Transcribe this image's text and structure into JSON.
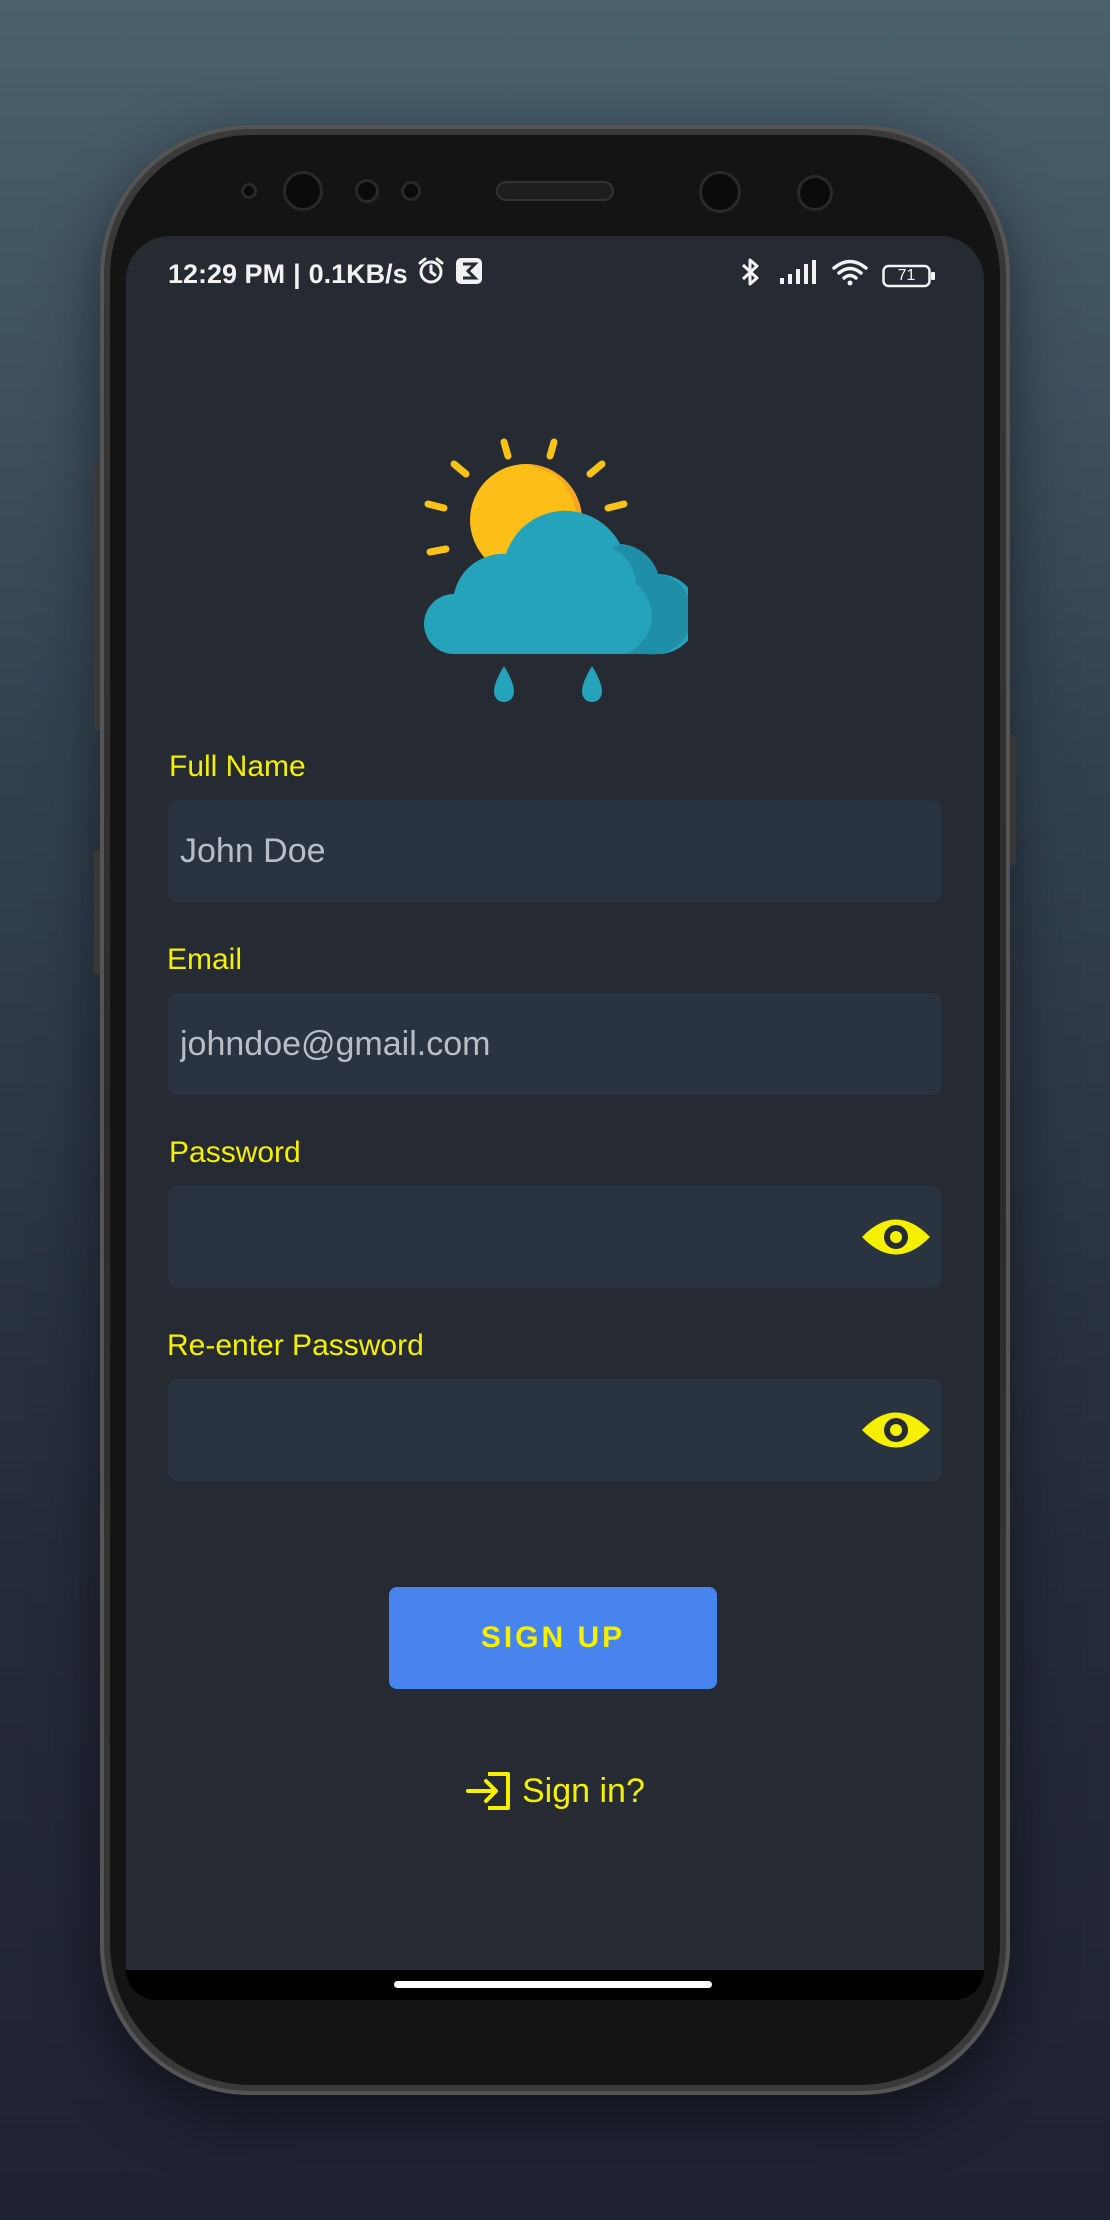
{
  "status_bar": {
    "time": "12:29 PM",
    "separator": "|",
    "network_speed": "0.1KB/s",
    "battery_level": "71",
    "icons": [
      "alarm-icon",
      "notification-app-icon",
      "bluetooth-icon",
      "signal-icon",
      "wifi-icon",
      "battery-icon"
    ]
  },
  "logo": {
    "icon": "weather-sun-cloud-rain-icon"
  },
  "form": {
    "full_name": {
      "label": "Full Name",
      "value": "",
      "placeholder": "John Doe"
    },
    "email": {
      "label": "Email",
      "value": "",
      "placeholder": "johndoe@gmail.com"
    },
    "password": {
      "label": "Password",
      "value": "",
      "placeholder": "",
      "toggle_icon": "eye-icon"
    },
    "confirm_password": {
      "label": "Re-enter Password",
      "value": "",
      "placeholder": "",
      "toggle_icon": "eye-icon"
    }
  },
  "actions": {
    "signup_label": "SIGN UP",
    "signin_label": "Sign in?",
    "signin_icon": "login-arrow-icon"
  },
  "colors": {
    "accent_text": "#f5f000",
    "button": "#4884ee",
    "screen_bg": "#262a33",
    "field_bg": "#2a3440"
  }
}
